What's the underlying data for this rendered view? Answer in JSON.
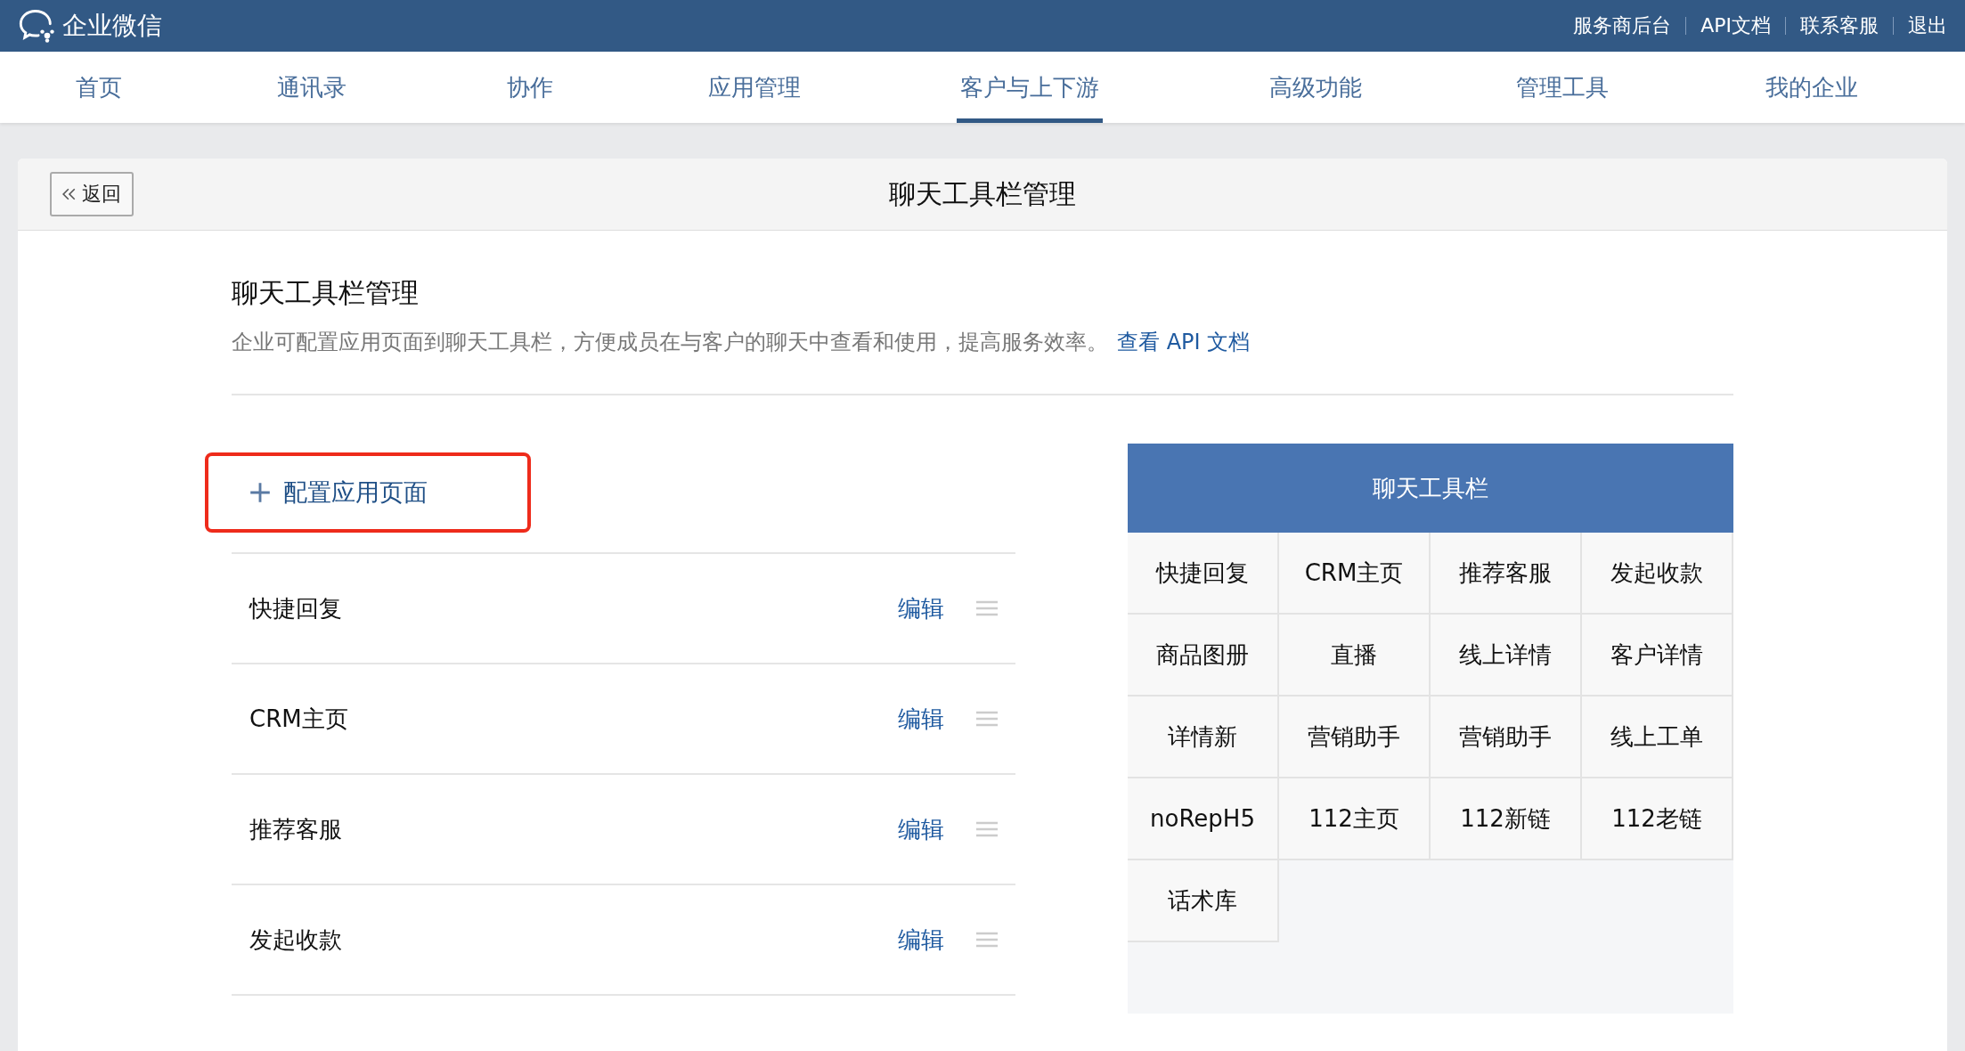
{
  "top_bar": {
    "logo_text": "企业微信",
    "links": [
      "服务商后台",
      "API文档",
      "联系客服",
      "退出"
    ]
  },
  "nav_tabs": [
    {
      "label": "首页",
      "selected": false
    },
    {
      "label": "通讯录",
      "selected": false
    },
    {
      "label": "协作",
      "selected": false
    },
    {
      "label": "应用管理",
      "selected": false
    },
    {
      "label": "客户与上下游",
      "selected": true
    },
    {
      "label": "高级功能",
      "selected": false
    },
    {
      "label": "管理工具",
      "selected": false
    },
    {
      "label": "我的企业",
      "selected": false
    }
  ],
  "page_header": {
    "back_button": "返回",
    "title": "聊天工具栏管理"
  },
  "section": {
    "title": "聊天工具栏管理",
    "description": "企业可配置应用页面到聊天工具栏，方便成员在与客户的聊天中查看和使用，提高服务效率。",
    "link": "查看 API 文档"
  },
  "config_button": {
    "label": "配置应用页面",
    "highlighted": true
  },
  "app_pages": [
    {
      "name": "快捷回复",
      "action": "编辑"
    },
    {
      "name": "CRM主页",
      "action": "编辑"
    },
    {
      "name": "推荐客服",
      "action": "编辑"
    },
    {
      "name": "发起收款",
      "action": "编辑"
    }
  ],
  "toolbar_preview": {
    "title": "聊天工具栏",
    "items": [
      "快捷回复",
      "CRM主页",
      "推荐客服",
      "发起收款",
      "商品图册",
      "直播",
      "线上详情",
      "客户详情",
      "详情新",
      "营销助手",
      "营销助手",
      "线上工单",
      "noRepH5",
      "112主页",
      "112新链",
      "112老链",
      "话术库"
    ]
  }
}
